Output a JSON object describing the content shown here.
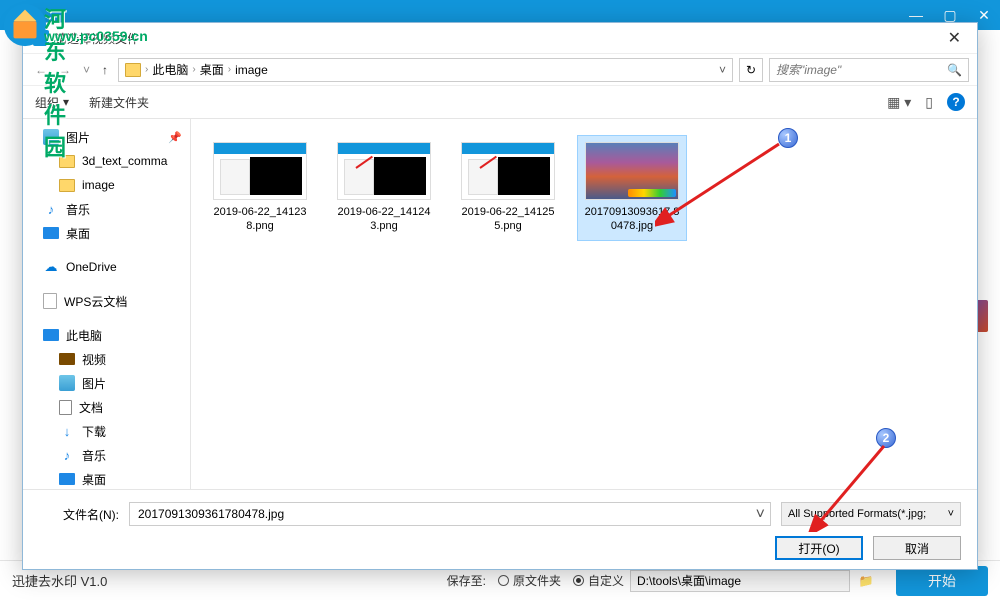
{
  "watermark": {
    "cn": "河东软件园",
    "url": "www.pc0359.cn"
  },
  "bgApp": {
    "footer": {
      "title": "迅捷去水印 V1.0",
      "saveLabel": "保存至:",
      "radioOriginal": "原文件夹",
      "radioCustom": "自定义",
      "path": "D:\\tools\\桌面\\image",
      "startBtn": "开始"
    }
  },
  "dialog": {
    "title": "请选择视频文件",
    "breadcrumbs": [
      "此电脑",
      "桌面",
      "image"
    ],
    "searchPlaceholder": "搜索\"image\"",
    "toolbar": {
      "organize": "组织",
      "newFolder": "新建文件夹"
    },
    "sidebar": [
      {
        "label": "图片",
        "icon": "ico-pic",
        "pin": true
      },
      {
        "label": "3d_text_comma",
        "icon": "ico-folder",
        "indent": true
      },
      {
        "label": "image",
        "icon": "ico-folder",
        "indent": true
      },
      {
        "label": "音乐",
        "icon": "ico-music",
        "indent": false,
        "glyph": "♪"
      },
      {
        "label": "桌面",
        "icon": "ico-desktop",
        "indent": false
      },
      {
        "label": "",
        "spacer": true
      },
      {
        "label": "OneDrive",
        "icon": "ico-cloud",
        "glyph": "☁"
      },
      {
        "label": "",
        "spacer": true
      },
      {
        "label": "WPS云文档",
        "icon": "ico-wps"
      },
      {
        "label": "",
        "spacer": true
      },
      {
        "label": "此电脑",
        "icon": "ico-pc"
      },
      {
        "label": "视频",
        "icon": "ico-video",
        "indent": true
      },
      {
        "label": "图片",
        "icon": "ico-pic",
        "indent": true
      },
      {
        "label": "文档",
        "icon": "ico-doc",
        "indent": true
      },
      {
        "label": "下载",
        "icon": "ico-dl",
        "indent": true,
        "glyph": "↓"
      },
      {
        "label": "音乐",
        "icon": "ico-music",
        "indent": true,
        "glyph": "♪"
      },
      {
        "label": "桌面",
        "icon": "ico-desktop",
        "indent": true
      }
    ],
    "files": [
      {
        "name": "2019-06-22_141238.png",
        "type": "screenshot",
        "arrow": false
      },
      {
        "name": "2019-06-22_141243.png",
        "type": "screenshot",
        "arrow": true
      },
      {
        "name": "2019-06-22_141255.png",
        "type": "screenshot",
        "arrow": true
      },
      {
        "name": "20170913093617 80478.jpg",
        "type": "photo",
        "selected": true
      }
    ],
    "fileNameLabel": "文件名(N):",
    "fileNameValue": "2017091309361780478.jpg",
    "formatFilter": "All Supported Formats(*.jpg;",
    "openBtn": "打开(O)",
    "cancelBtn": "取消"
  },
  "annotations": {
    "badge1": "1",
    "badge2": "2"
  }
}
